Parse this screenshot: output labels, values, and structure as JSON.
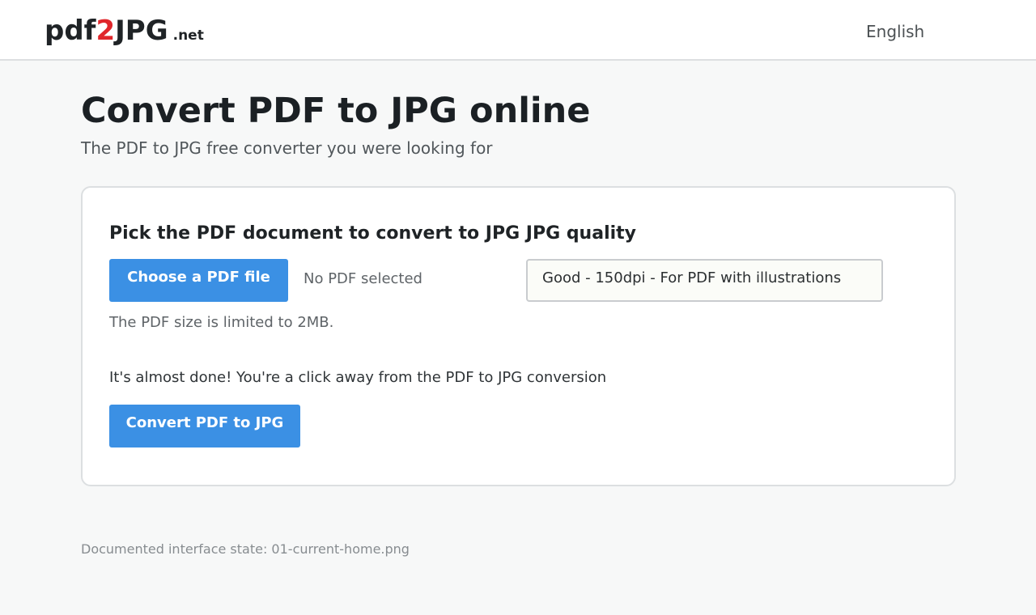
{
  "header": {
    "logo": {
      "part1": "pdf",
      "part2": "2",
      "part3": "JPG",
      "tld": ".net"
    },
    "language": "English"
  },
  "main": {
    "title": "Convert PDF to JPG online",
    "subtitle": "The PDF to JPG free converter you were looking for"
  },
  "form": {
    "heading": "Pick the PDF document to convert to JPG JPG quality",
    "choose_button": "Choose a PDF file",
    "file_status": "No PDF selected",
    "quality_selected": "Good - 150dpi - For PDF with illustrations",
    "size_note": "The PDF size is limited to 2MB.",
    "almost_done": "It's almost done! You're a click away from the PDF to JPG conversion",
    "convert_button": "Convert PDF to JPG"
  },
  "footer": {
    "note": "Documented interface state: 01-current-home.png"
  },
  "colors": {
    "accent": "#3b90e4",
    "logo_highlight": "#e0262b"
  }
}
